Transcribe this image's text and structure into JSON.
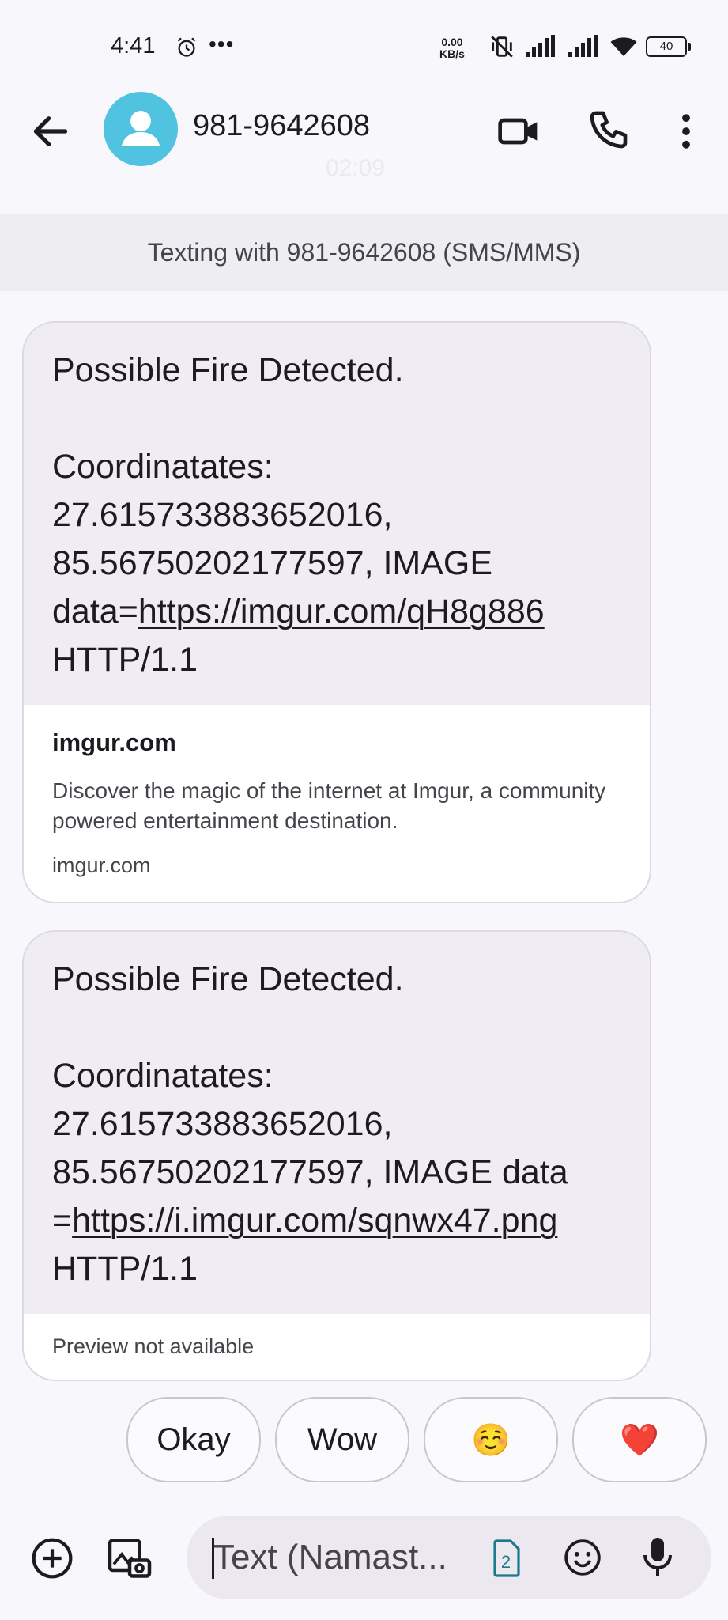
{
  "status_bar": {
    "time": "4:41",
    "overflow": "•••",
    "net_speed_value": "0.00",
    "net_speed_unit": "KB/s",
    "battery": "40",
    "icons": [
      "alarm-icon",
      "muted-vibrate-icon",
      "signal-icon",
      "signal-icon",
      "wifi-icon",
      "battery-icon"
    ]
  },
  "header": {
    "contact": "981-9642608",
    "timestamp": "02:09",
    "icons": [
      "back-arrow-icon",
      "avatar-person-icon",
      "video-call-icon",
      "phone-icon",
      "more-vert-icon"
    ]
  },
  "banner": {
    "text": "Texting with 981-9642608 (SMS/MMS)"
  },
  "messages": [
    {
      "line1": "Possible Fire Detected.",
      "body_pre": "Coordinatates: 27.615733883652016, 85.56750202177597, IMAGE data=",
      "link": "https://imgur.com/qH8g886",
      "body_post": "HTTP/1.1",
      "preview": {
        "title": "imgur.com",
        "description": "Discover the magic of the internet at Imgur, a community powered entertainment destination.",
        "url": "imgur.com"
      }
    },
    {
      "line1": "Possible Fire Detected.",
      "body_pre": "Coordinatates: 27.615733883652016, 85.56750202177597, IMAGE data =",
      "link": "https://i.imgur.com/sqnwx47.png",
      "body_post": "HTTP/1.1",
      "preview_none": "Preview not available"
    }
  ],
  "smart_replies": [
    "Okay",
    "Wow",
    "☺️",
    "❤️"
  ],
  "compose": {
    "placeholder": "Text (Namast...",
    "sim_number": "2",
    "icons": [
      "add-icon",
      "gallery-icon",
      "sim-icon",
      "emoji-icon",
      "mic-icon"
    ]
  },
  "colors": {
    "background": "#f8f7fb",
    "bubble": "#efedf3",
    "avatar": "#4fc3e0",
    "banner": "#eeedf2",
    "sim_icon": "#1b7a8c"
  }
}
